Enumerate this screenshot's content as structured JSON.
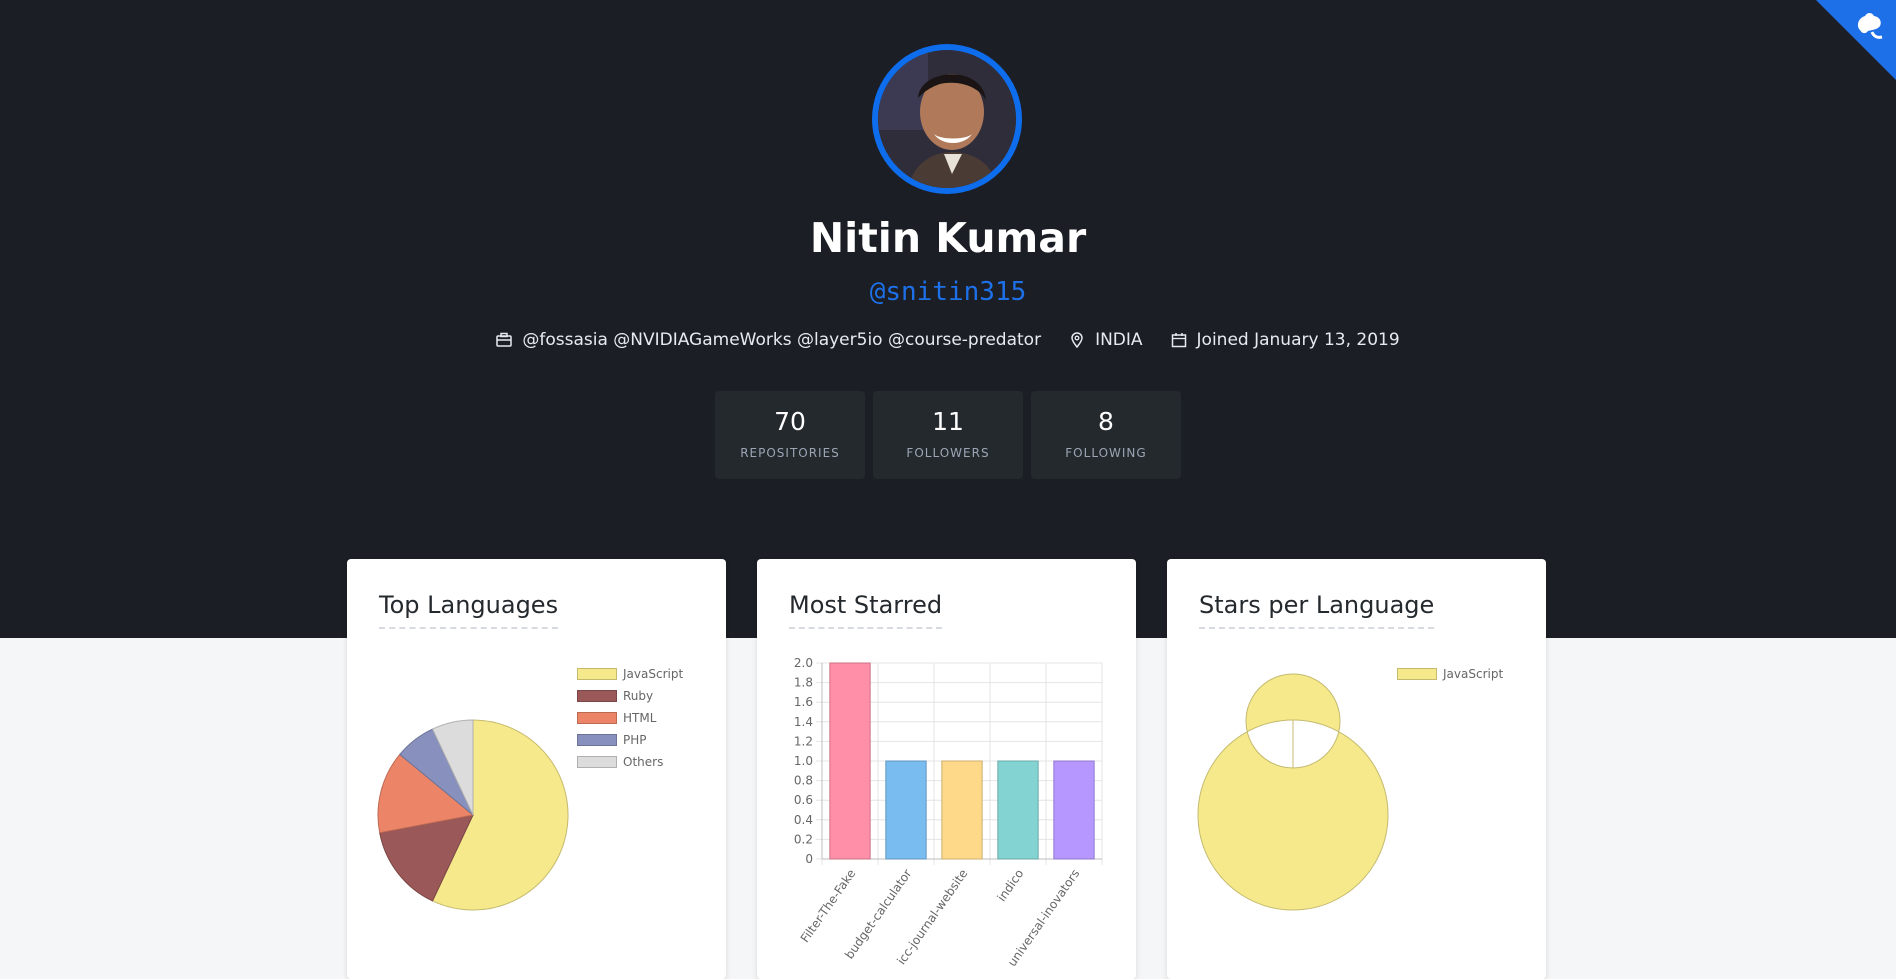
{
  "profile": {
    "name": "Nitin Kumar",
    "handle": "@snitin315",
    "company": "@fossasia @NVIDIAGameWorks @layer5io @course-predator",
    "location": "INDIA",
    "joined": "Joined January 13, 2019"
  },
  "stats": [
    {
      "value": "70",
      "label": "REPOSITORIES"
    },
    {
      "value": "11",
      "label": "FOLLOWERS"
    },
    {
      "value": "8",
      "label": "FOLLOWING"
    }
  ],
  "colors": {
    "accent": "#1e70e8",
    "hero_bg": "#1b1e24"
  },
  "icons": {
    "corner": "octocat-icon",
    "company": "briefcase-icon",
    "location": "map-pin-icon",
    "joined": "calendar-icon"
  },
  "cards": {
    "top_languages": {
      "title": "Top Languages"
    },
    "most_starred": {
      "title": "Most Starred"
    },
    "stars_per_language": {
      "title": "Stars per Language"
    }
  },
  "chart_data": [
    {
      "type": "pie",
      "title": "Top Languages",
      "legend_position": "top-right",
      "series": [
        {
          "name": "JavaScript",
          "value": 57,
          "color": "#f5e98b"
        },
        {
          "name": "Ruby",
          "value": 15,
          "color": "#9b5858"
        },
        {
          "name": "HTML",
          "value": 14,
          "color": "#ec8568"
        },
        {
          "name": "PHP",
          "value": 7,
          "color": "#8890bd"
        },
        {
          "name": "Others",
          "value": 7,
          "color": "#dcdcdc"
        }
      ]
    },
    {
      "type": "bar",
      "title": "Most Starred",
      "categories": [
        "Filter-The-Fake",
        "budget-calculator",
        "icc-journal-website",
        "indico",
        "universal-inovators"
      ],
      "values": [
        2,
        1,
        1,
        1,
        1
      ],
      "colors": [
        "#ff8fa8",
        "#79bdf0",
        "#ffd98a",
        "#84d3d3",
        "#b597ff"
      ],
      "ylim": [
        0,
        2
      ],
      "yticks": [
        "2.0",
        "1.8",
        "1.6",
        "1.4",
        "1.2",
        "1.0",
        "0.8",
        "0.6",
        "0.4",
        "0.2",
        "0"
      ],
      "grid": true
    },
    {
      "type": "pie",
      "subtype": "doughnut",
      "title": "Stars per Language",
      "legend_position": "top-right",
      "series": [
        {
          "name": "JavaScript",
          "value": 6,
          "color": "#f5e98b"
        }
      ]
    }
  ]
}
